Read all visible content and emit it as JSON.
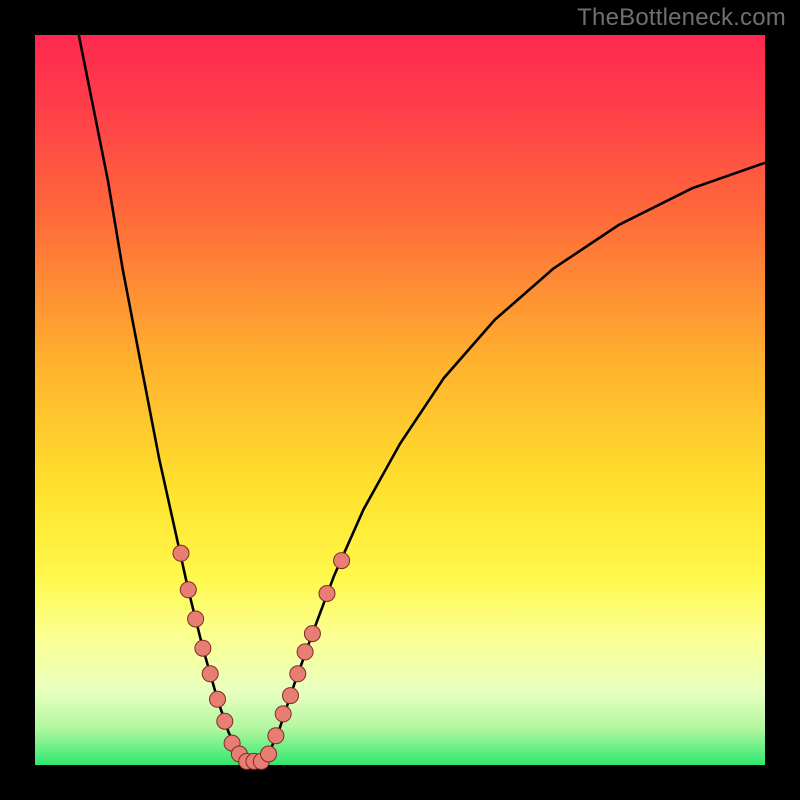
{
  "watermark": "TheBottleneck.com",
  "colors": {
    "frame": "#000000",
    "curve": "#000000",
    "dot_fill": "#e87e73",
    "dot_stroke": "#7c2d22"
  },
  "chart_data": {
    "type": "line",
    "title": "",
    "xlabel": "",
    "ylabel": "",
    "xlim": [
      0,
      100
    ],
    "ylim": [
      0,
      100
    ],
    "curve": [
      {
        "x": 6.0,
        "y": 100.0
      },
      {
        "x": 8.0,
        "y": 90.0
      },
      {
        "x": 10.0,
        "y": 80.0
      },
      {
        "x": 12.0,
        "y": 68.0
      },
      {
        "x": 14.5,
        "y": 55.0
      },
      {
        "x": 17.0,
        "y": 42.0
      },
      {
        "x": 19.0,
        "y": 33.0
      },
      {
        "x": 21.0,
        "y": 24.0
      },
      {
        "x": 23.0,
        "y": 16.0
      },
      {
        "x": 25.0,
        "y": 9.0
      },
      {
        "x": 26.5,
        "y": 4.5
      },
      {
        "x": 28.0,
        "y": 1.5
      },
      {
        "x": 29.0,
        "y": 0.5
      },
      {
        "x": 30.0,
        "y": 0.5
      },
      {
        "x": 31.0,
        "y": 0.5
      },
      {
        "x": 32.0,
        "y": 1.5
      },
      {
        "x": 33.5,
        "y": 5.0
      },
      {
        "x": 35.5,
        "y": 11.0
      },
      {
        "x": 38.0,
        "y": 18.0
      },
      {
        "x": 41.0,
        "y": 26.0
      },
      {
        "x": 45.0,
        "y": 35.0
      },
      {
        "x": 50.0,
        "y": 44.0
      },
      {
        "x": 56.0,
        "y": 53.0
      },
      {
        "x": 63.0,
        "y": 61.0
      },
      {
        "x": 71.0,
        "y": 68.0
      },
      {
        "x": 80.0,
        "y": 74.0
      },
      {
        "x": 90.0,
        "y": 79.0
      },
      {
        "x": 100.0,
        "y": 82.5
      }
    ],
    "dots": [
      {
        "x": 20.0,
        "y": 29.0
      },
      {
        "x": 21.0,
        "y": 24.0
      },
      {
        "x": 22.0,
        "y": 20.0
      },
      {
        "x": 23.0,
        "y": 16.0
      },
      {
        "x": 24.0,
        "y": 12.5
      },
      {
        "x": 25.0,
        "y": 9.0
      },
      {
        "x": 26.0,
        "y": 6.0
      },
      {
        "x": 27.0,
        "y": 3.0
      },
      {
        "x": 28.0,
        "y": 1.5
      },
      {
        "x": 29.0,
        "y": 0.5
      },
      {
        "x": 30.0,
        "y": 0.5
      },
      {
        "x": 31.0,
        "y": 0.5
      },
      {
        "x": 32.0,
        "y": 1.5
      },
      {
        "x": 33.0,
        "y": 4.0
      },
      {
        "x": 34.0,
        "y": 7.0
      },
      {
        "x": 35.0,
        "y": 9.5
      },
      {
        "x": 36.0,
        "y": 12.5
      },
      {
        "x": 37.0,
        "y": 15.5
      },
      {
        "x": 38.0,
        "y": 18.0
      },
      {
        "x": 40.0,
        "y": 23.5
      },
      {
        "x": 42.0,
        "y": 28.0
      }
    ]
  }
}
